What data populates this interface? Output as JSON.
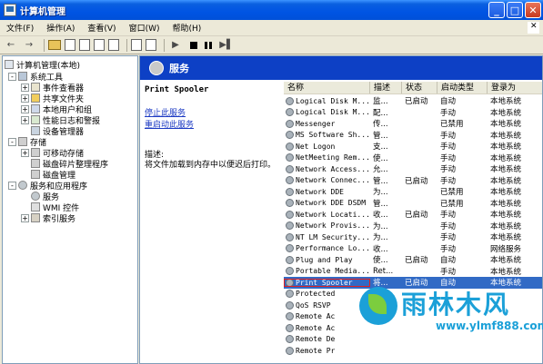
{
  "window": {
    "title": "计算机管理"
  },
  "menu": [
    "文件(F)",
    "操作(A)",
    "查看(V)",
    "窗口(W)",
    "帮助(H)"
  ],
  "tree": {
    "root": "计算机管理(本地)",
    "items": [
      {
        "label": "系统工具",
        "level": 1,
        "expander": "-",
        "icon": "tools-icon"
      },
      {
        "label": "事件查看器",
        "level": 2,
        "expander": "+",
        "icon": "event-viewer-icon"
      },
      {
        "label": "共享文件夹",
        "level": 2,
        "expander": "+",
        "icon": "shared-folder-icon"
      },
      {
        "label": "本地用户和组",
        "level": 2,
        "expander": "+",
        "icon": "users-icon"
      },
      {
        "label": "性能日志和警报",
        "level": 2,
        "expander": "+",
        "icon": "performance-icon"
      },
      {
        "label": "设备管理器",
        "level": 2,
        "expander": "",
        "icon": "device-manager-icon"
      },
      {
        "label": "存储",
        "level": 1,
        "expander": "-",
        "icon": "storage-icon"
      },
      {
        "label": "可移动存储",
        "level": 2,
        "expander": "+",
        "icon": "removable-storage-icon"
      },
      {
        "label": "磁盘碎片整理程序",
        "level": 2,
        "expander": "",
        "icon": "defrag-icon"
      },
      {
        "label": "磁盘管理",
        "level": 2,
        "expander": "",
        "icon": "disk-management-icon"
      },
      {
        "label": "服务和应用程序",
        "level": 1,
        "expander": "-",
        "icon": "services-apps-icon"
      },
      {
        "label": "服务",
        "level": 2,
        "expander": "",
        "icon": "services-icon"
      },
      {
        "label": "WMI 控件",
        "level": 2,
        "expander": "",
        "icon": "wmi-icon"
      },
      {
        "label": "索引服务",
        "level": 2,
        "expander": "+",
        "icon": "indexing-icon"
      }
    ]
  },
  "panel": {
    "title": "服务",
    "selected_service": "Print Spooler",
    "stop_link": "停止此服务",
    "restart_link": "重启动此服务",
    "desc_label": "描述:",
    "desc_text": "将文件加载到内存中以便迟后打印。"
  },
  "list": {
    "columns": [
      "名称",
      "描述",
      "状态",
      "启动类型",
      "登录为"
    ],
    "rows": [
      [
        "Logical Disk M...",
        "监...",
        "已启动",
        "自动",
        "本地系统"
      ],
      [
        "Logical Disk M...",
        "配...",
        "",
        "手动",
        "本地系统"
      ],
      [
        "Messenger",
        "传...",
        "",
        "已禁用",
        "本地系统"
      ],
      [
        "MS Software Sh...",
        "管...",
        "",
        "手动",
        "本地系统"
      ],
      [
        "Net Logon",
        "支...",
        "",
        "手动",
        "本地系统"
      ],
      [
        "NetMeeting Rem...",
        "使...",
        "",
        "手动",
        "本地系统"
      ],
      [
        "Network Access...",
        "允...",
        "",
        "手动",
        "本地系统"
      ],
      [
        "Network Connec...",
        "管...",
        "已启动",
        "手动",
        "本地系统"
      ],
      [
        "Network DDE",
        "为...",
        "",
        "已禁用",
        "本地系统"
      ],
      [
        "Network DDE DSDM",
        "管...",
        "",
        "已禁用",
        "本地系统"
      ],
      [
        "Network Locati...",
        "收...",
        "已启动",
        "手动",
        "本地系统"
      ],
      [
        "Network Provis...",
        "为...",
        "",
        "手动",
        "本地系统"
      ],
      [
        "NT LM Security...",
        "为...",
        "",
        "手动",
        "本地系统"
      ],
      [
        "Performance Lo...",
        "收...",
        "",
        "手动",
        "网络服务"
      ],
      [
        "Plug and Play",
        "使...",
        "已启动",
        "自动",
        "本地系统"
      ],
      [
        "Portable Media...",
        "Ret...",
        "",
        "手动",
        "本地系统"
      ],
      [
        "Print Spooler",
        "将...",
        "已启动",
        "自动",
        "本地系统"
      ],
      [
        "Protected",
        "",
        "",
        "",
        ""
      ],
      [
        "QoS RSVP",
        "",
        "",
        "",
        ""
      ],
      [
        "Remote Ac",
        "",
        "",
        "",
        ""
      ],
      [
        "Remote Ac",
        "",
        "",
        "",
        ""
      ],
      [
        "Remote De",
        "",
        "",
        "",
        ""
      ],
      [
        "Remote Pr",
        "",
        "",
        "",
        ""
      ]
    ],
    "selected_index": 16
  },
  "watermark": {
    "text": "雨林木风",
    "url": "www.ylmf888.com"
  }
}
